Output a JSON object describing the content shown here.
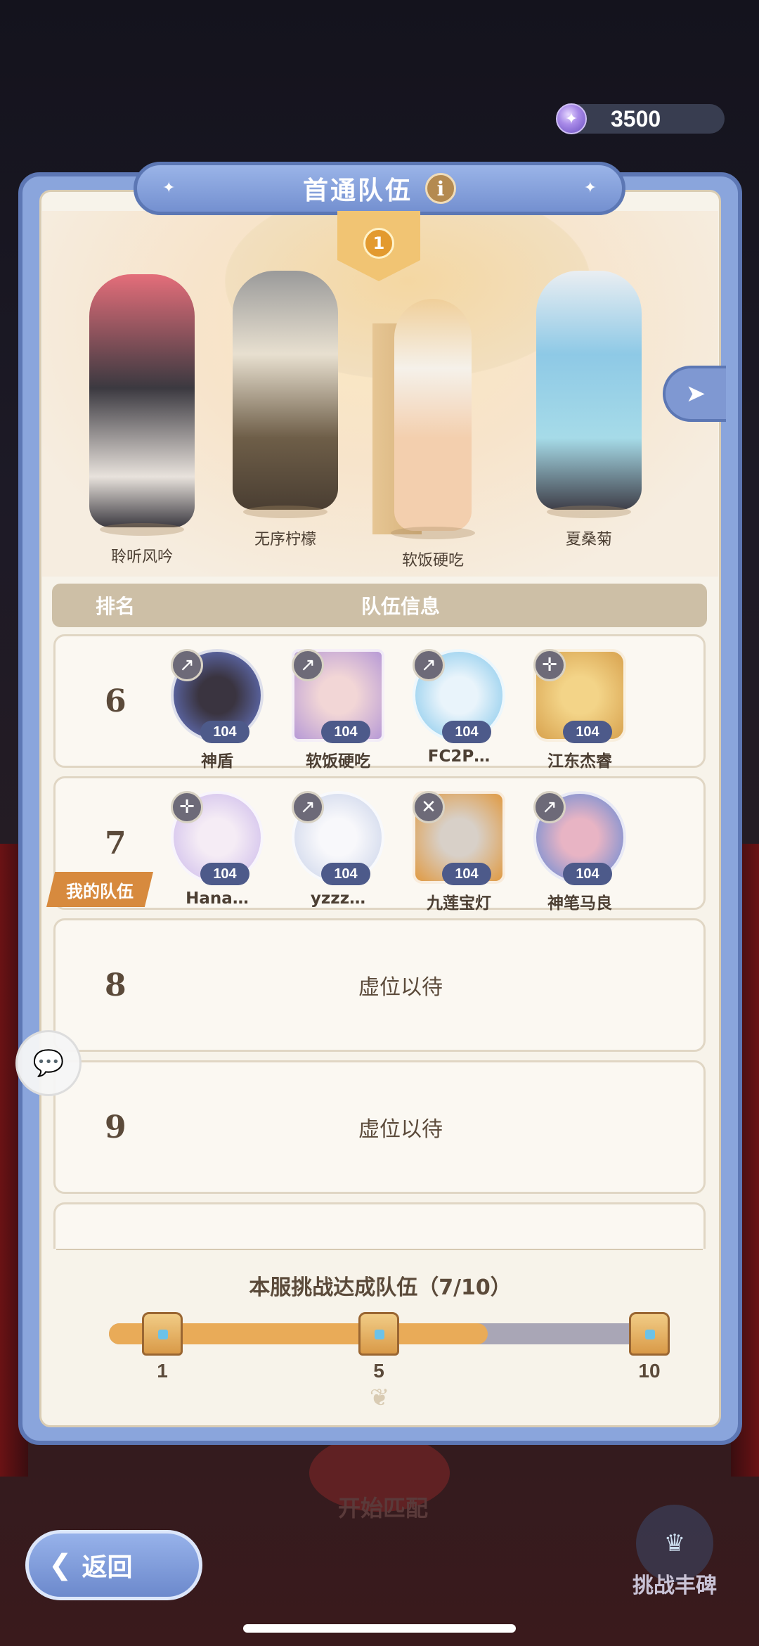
{
  "currency": {
    "icon": "gem-icon",
    "amount": "3500"
  },
  "panel": {
    "title": "首通队伍",
    "info_icon": "i"
  },
  "scene": {
    "rank_badge": "1",
    "heroes": [
      {
        "name": "聆听风吟",
        "color": "#e46e7a"
      },
      {
        "name": "无序柠檬",
        "color": "#8a8a8a"
      },
      {
        "name": "软饭硬吃",
        "color": "#f0cf9a"
      },
      {
        "name": "夏桑菊",
        "color": "#8ec9e6"
      }
    ]
  },
  "table": {
    "header_rank": "排名",
    "header_info": "队伍信息",
    "rows": [
      {
        "rank": "6",
        "members": [
          {
            "name": "神盾",
            "level": "104",
            "class_icon": "↗",
            "color": "#6c7fd8"
          },
          {
            "name": "软饭硬吃",
            "level": "104",
            "class_icon": "↗",
            "color": "#b79ad6"
          },
          {
            "name": "FC2P…",
            "level": "104",
            "class_icon": "↗",
            "color": "#7cc4ea"
          },
          {
            "name": "江东杰睿",
            "level": "104",
            "class_icon": "✛",
            "color": "#d8a24e"
          }
        ]
      },
      {
        "rank": "7",
        "members": [
          {
            "name": "Hana…",
            "level": "104",
            "class_icon": "✛",
            "color": "#c9b6ea"
          },
          {
            "name": "yzzz…",
            "level": "104",
            "class_icon": "↗",
            "color": "#c6d0e8"
          },
          {
            "name": "九莲宝灯",
            "level": "104",
            "class_icon": "✕",
            "color": "#e09a42"
          },
          {
            "name": "神笔马良",
            "level": "104",
            "class_icon": "↗",
            "color": "#5a86d6"
          }
        ]
      },
      {
        "rank": "8",
        "empty_text": "虚位以待"
      },
      {
        "rank": "9",
        "empty_text": "虚位以待"
      }
    ]
  },
  "my_team_label": "我的队伍",
  "progress": {
    "title": "本服挑战达成队伍（7/10）",
    "current": 7,
    "max": 10,
    "milestones": [
      "1",
      "5",
      "10"
    ]
  },
  "bottom": {
    "start_match": "开始匹配",
    "back": "返回",
    "monument": "挑战丰碑"
  }
}
